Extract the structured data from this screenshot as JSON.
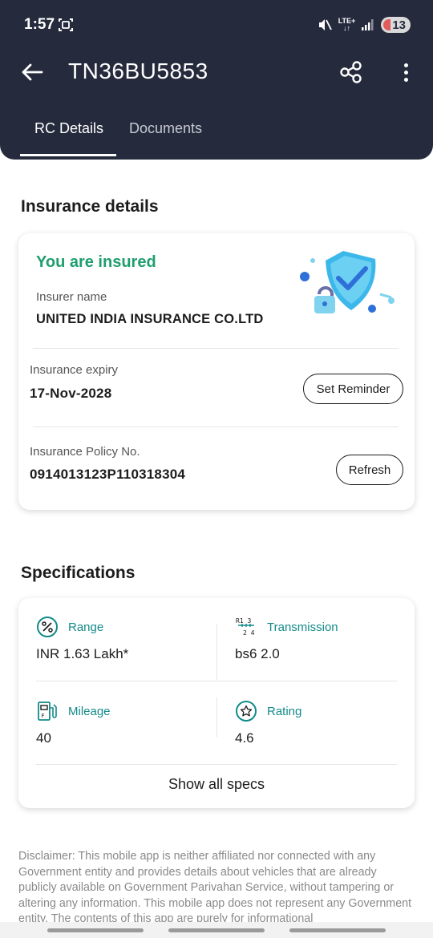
{
  "status_bar": {
    "time": "1:57",
    "network": "LTE+",
    "battery": "13"
  },
  "app_bar": {
    "title": "TN36BU5853"
  },
  "tabs": [
    {
      "label": "RC Details",
      "active": true
    },
    {
      "label": "Documents",
      "active": false
    }
  ],
  "insurance": {
    "section_title": "Insurance details",
    "status": "You are insured",
    "insurer_label": "Insurer name",
    "insurer_value": "UNITED INDIA INSURANCE CO.LTD",
    "expiry_label": "Insurance expiry",
    "expiry_value": "17-Nov-2028",
    "reminder_button": "Set Reminder",
    "policy_label": "Insurance Policy No.",
    "policy_value": "0914013123P110318304",
    "refresh_button": "Refresh"
  },
  "specifications": {
    "section_title": "Specifications",
    "items": [
      {
        "label": "Range",
        "value": "INR 1.63 Lakh*",
        "icon": "percent-icon"
      },
      {
        "label": "Transmission",
        "value": "bs6 2.0",
        "icon": "gear-shift-icon"
      },
      {
        "label": "Mileage",
        "value": "40",
        "icon": "fuel-pump-icon"
      },
      {
        "label": "Rating",
        "value": "4.6",
        "icon": "star-icon"
      }
    ],
    "show_all": "Show all specs"
  },
  "disclaimer": "Disclaimer: This mobile app is neither affiliated nor connected with any Government entity and provides details about vehicles that are already publicly available on Government Parivahan Service, without tampering or altering any information. This mobile app does not represent any Government entity. The contents of this app are purely for informational",
  "colors": {
    "header_bg": "#262a3d",
    "insured_green": "#1f9e6e",
    "spec_teal": "#138a8a"
  }
}
